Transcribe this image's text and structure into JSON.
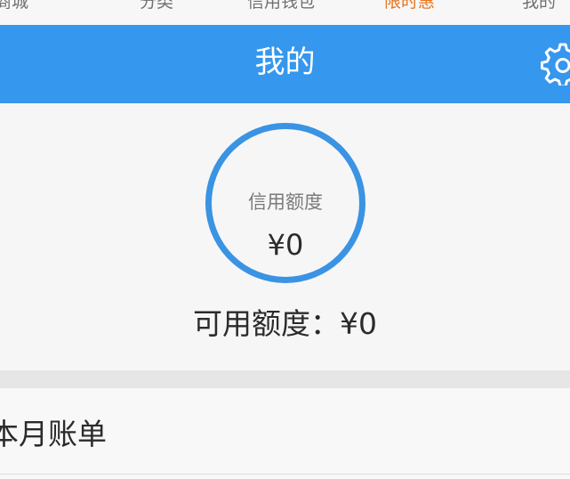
{
  "tabs": [
    {
      "label": "商城"
    },
    {
      "label": "分类"
    },
    {
      "label": "信用钱包"
    },
    {
      "label": "限时惠"
    },
    {
      "label": "我的"
    }
  ],
  "header": {
    "title": "我的",
    "settings_icon": "gear-icon"
  },
  "credit": {
    "label": "信用额度",
    "value": "¥0",
    "available_text": "可用额度：¥0"
  },
  "bill": {
    "label": "本月账单"
  },
  "colors": {
    "header_blue": "#3597ed",
    "ring_blue": "#3a93e3",
    "active_tab": "#e8741f"
  }
}
